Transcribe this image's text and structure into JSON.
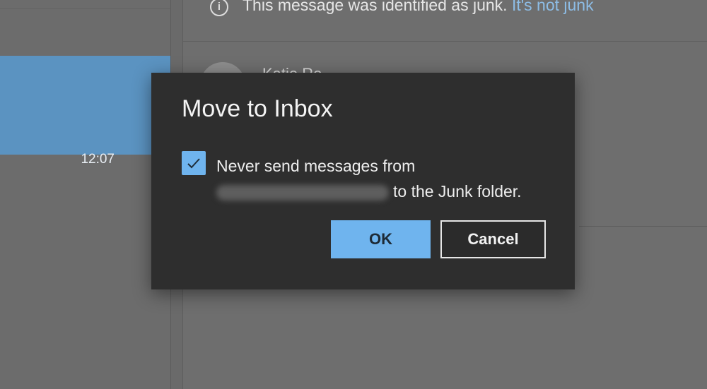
{
  "background": {
    "message_list": {
      "selected_item_time": "12:07"
    },
    "reading_pane": {
      "junk_banner_text": "This message was identified as junk.",
      "junk_banner_link": "It's not junk",
      "sender_partial": "Katie Ro..."
    }
  },
  "dialog": {
    "title": "Move to Inbox",
    "checkbox_checked": true,
    "checkbox_label_line1": "Never send messages from",
    "checkbox_label_line2_suffix": "to the Junk folder.",
    "ok_label": "OK",
    "cancel_label": "Cancel"
  },
  "colors": {
    "accent": "#6fb4ee",
    "dialog_bg": "#2e2e2e",
    "link": "#8dbde6"
  }
}
